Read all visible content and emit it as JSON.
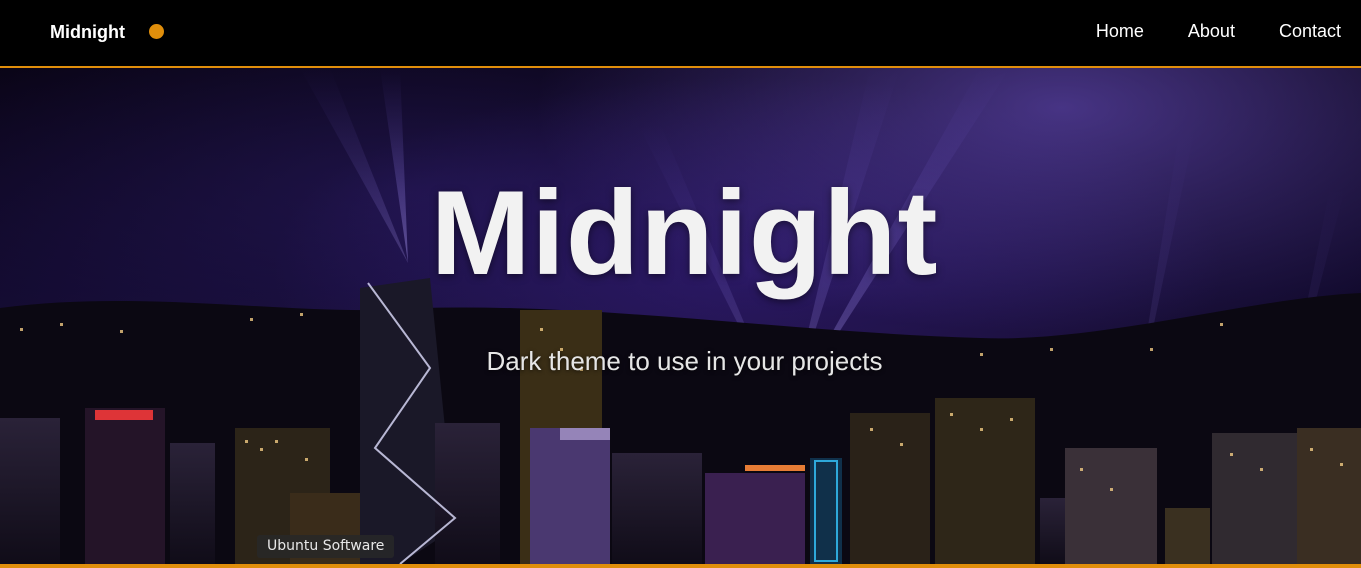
{
  "navbar": {
    "brand": "Midnight",
    "links": [
      "Home",
      "About",
      "Contact"
    ],
    "accent_color": "#e08e0b"
  },
  "hero": {
    "title": "Midnight",
    "subtitle": "Dark theme to use in your projects",
    "background": "night city skyline with searchlights"
  },
  "tooltip": {
    "text": "Ubuntu Software"
  }
}
